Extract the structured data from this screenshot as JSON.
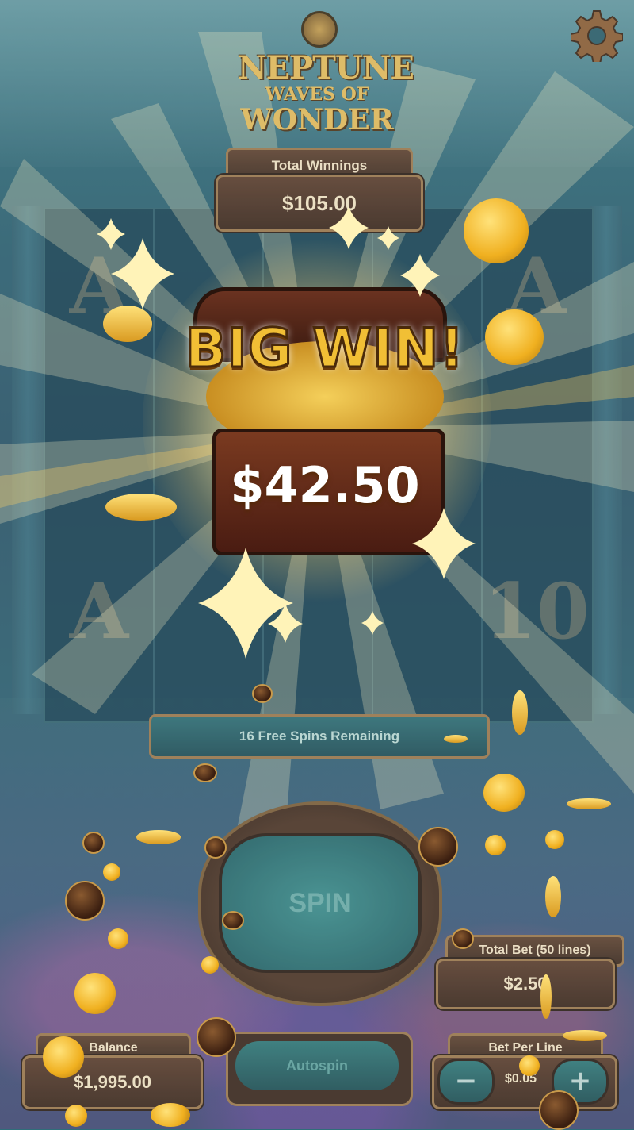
{
  "game": {
    "logo_line1": "NEPTUNE",
    "logo_line2": "WAVES OF",
    "logo_line3": "WONDER"
  },
  "header": {
    "settings_icon": "gear-icon"
  },
  "total_winnings": {
    "label": "Total Winnings",
    "value": "$105.00"
  },
  "reels": {
    "columns": [
      {
        "symbols": [
          "A",
          "",
          "A"
        ]
      },
      {
        "symbols": [
          "",
          "",
          ""
        ]
      },
      {
        "symbols": [
          "",
          "",
          ""
        ]
      },
      {
        "symbols": [
          "",
          "",
          ""
        ]
      },
      {
        "symbols": [
          "A",
          "",
          "10"
        ]
      }
    ]
  },
  "big_win": {
    "title": "BIG WIN!",
    "amount": "$42.50"
  },
  "free_spins": {
    "text": "16 Free Spins Remaining"
  },
  "controls": {
    "spin_label": "SPIN",
    "autospin_label": "Autospin",
    "total_bet_label": "Total Bet (50 lines)",
    "total_bet_value": "$2.50",
    "balance_label": "Balance",
    "balance_value": "$1,995.00",
    "bet_per_line_label": "Bet Per Line",
    "bet_per_line_value": "$0.05",
    "minus_label": "−",
    "plus_label": "+"
  },
  "colors": {
    "gold": "#f1bf35",
    "panel_brown": "#3a2418",
    "panel_border": "#9a7548",
    "teal_button": "#2e7473"
  }
}
